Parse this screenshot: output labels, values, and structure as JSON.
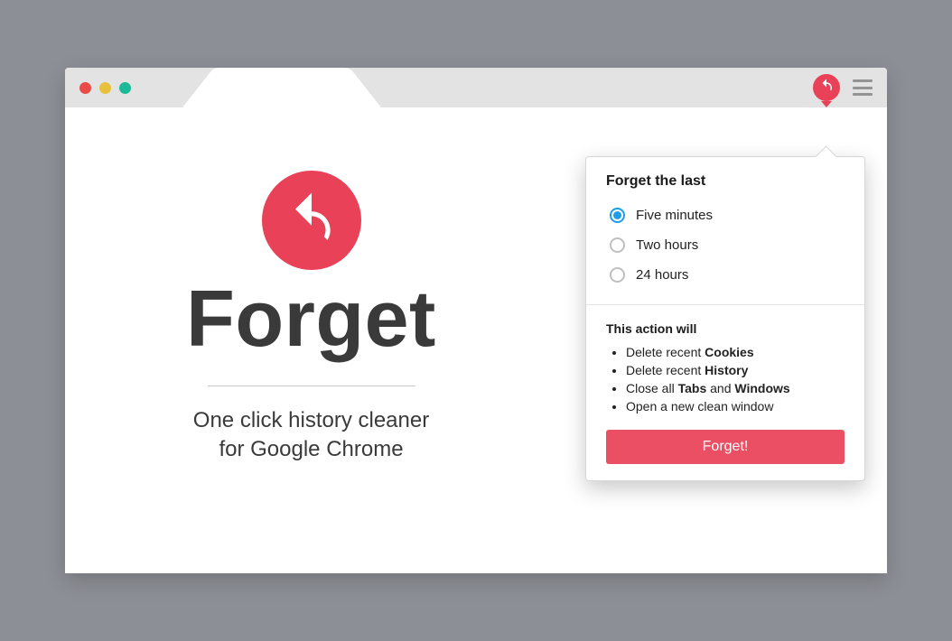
{
  "colors": {
    "accent": "#e94258",
    "radio_active": "#1e9ee6"
  },
  "hero": {
    "title": "Forget",
    "subtitle_line1": "One click history cleaner",
    "subtitle_line2": "for Google Chrome"
  },
  "popup": {
    "heading": "Forget the last",
    "options": [
      {
        "label": "Five minutes",
        "checked": true
      },
      {
        "label": "Two hours",
        "checked": false
      },
      {
        "label": "24 hours",
        "checked": false
      }
    ],
    "action_heading": "This action will",
    "bullets": [
      {
        "prefix": "Delete recent ",
        "bold": "Cookies",
        "suffix": ""
      },
      {
        "prefix": "Delete recent ",
        "bold": "History",
        "suffix": ""
      },
      {
        "prefix": "Close all ",
        "bold": "Tabs",
        "mid": " and ",
        "bold2": "Windows",
        "suffix": ""
      },
      {
        "prefix": "Open a new clean window",
        "bold": "",
        "suffix": ""
      }
    ],
    "button_label": "Forget!"
  }
}
